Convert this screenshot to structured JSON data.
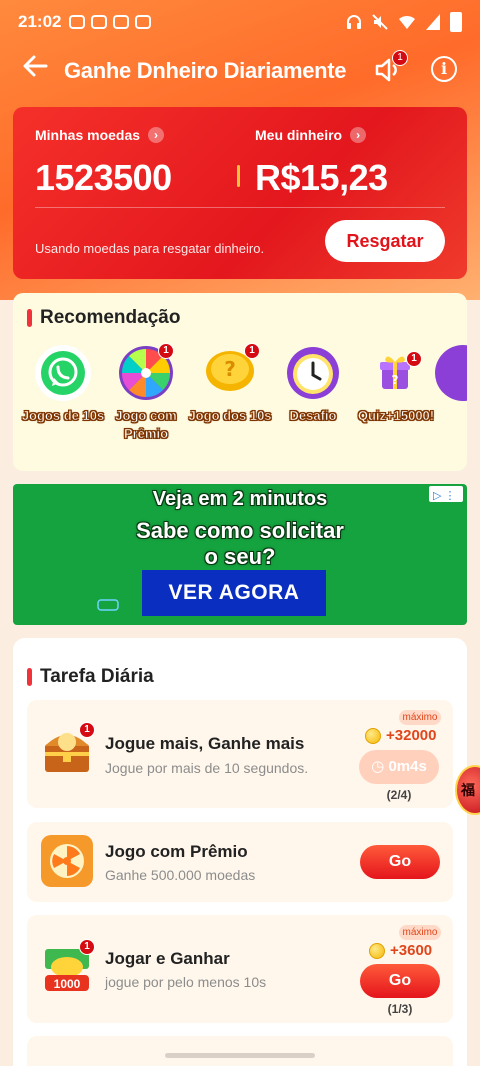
{
  "status_bar": {
    "time": "21:02",
    "icons": [
      "wifi-icon",
      "signal-icon",
      "battery-icon"
    ]
  },
  "header": {
    "title": "Ganhe Dnheiro Diariamente",
    "sound_badge": "1"
  },
  "balance": {
    "coins_label": "Minhas moedas",
    "coins_value": "1523500",
    "money_label": "Meu dinheiro",
    "money_value": "R$15,23",
    "note": "Usando moedas para resgatar dinheiro.",
    "redeem_button": "Resgatar"
  },
  "recommendations": {
    "title": "Recomendação",
    "items": [
      {
        "label": "Jogos de 10s",
        "icon": "whatsapp-icon",
        "badge": ""
      },
      {
        "label": "Jogo com Prêmio",
        "icon": "prize-wheel-icon",
        "badge": "1"
      },
      {
        "label": "Jogo dos 10s",
        "icon": "coin-question-icon",
        "badge": "1"
      },
      {
        "label": "Desafio",
        "icon": "clock-icon",
        "badge": ""
      },
      {
        "label": "Quiz+15000!",
        "icon": "gift-icon",
        "badge": "1"
      }
    ]
  },
  "ad": {
    "line1": "Veja em 2 minutos",
    "line2": "Sabe como solicitar",
    "line3": "o seu?",
    "cta": "VER AGORA"
  },
  "daily_tasks": {
    "title": "Tarefa Diária",
    "tasks": [
      {
        "title": "Jogue mais, Ganhe mais",
        "subtitle": "Jogue por mais de 10 segundos.",
        "max_tag": "máximo",
        "reward": "+32000",
        "button": "0m4s",
        "progress": "(2/4)",
        "badge": "1"
      },
      {
        "title": "Jogo com Prêmio",
        "subtitle": "Ganhe 500.000 moedas",
        "button": "Go"
      },
      {
        "title": "Jogar e Ganhar",
        "subtitle": "jogue por pelo menos 10s",
        "max_tag": "máximo",
        "reward": "+3600",
        "button": "Go",
        "progress": "(1/3)",
        "badge": "1",
        "icon_caption": "1000"
      }
    ]
  },
  "colors": {
    "brand_red": "#e3171d",
    "accent_orange": "#ff6b2a",
    "ad_green": "#15a33f",
    "ad_blue": "#0a2fc0"
  }
}
